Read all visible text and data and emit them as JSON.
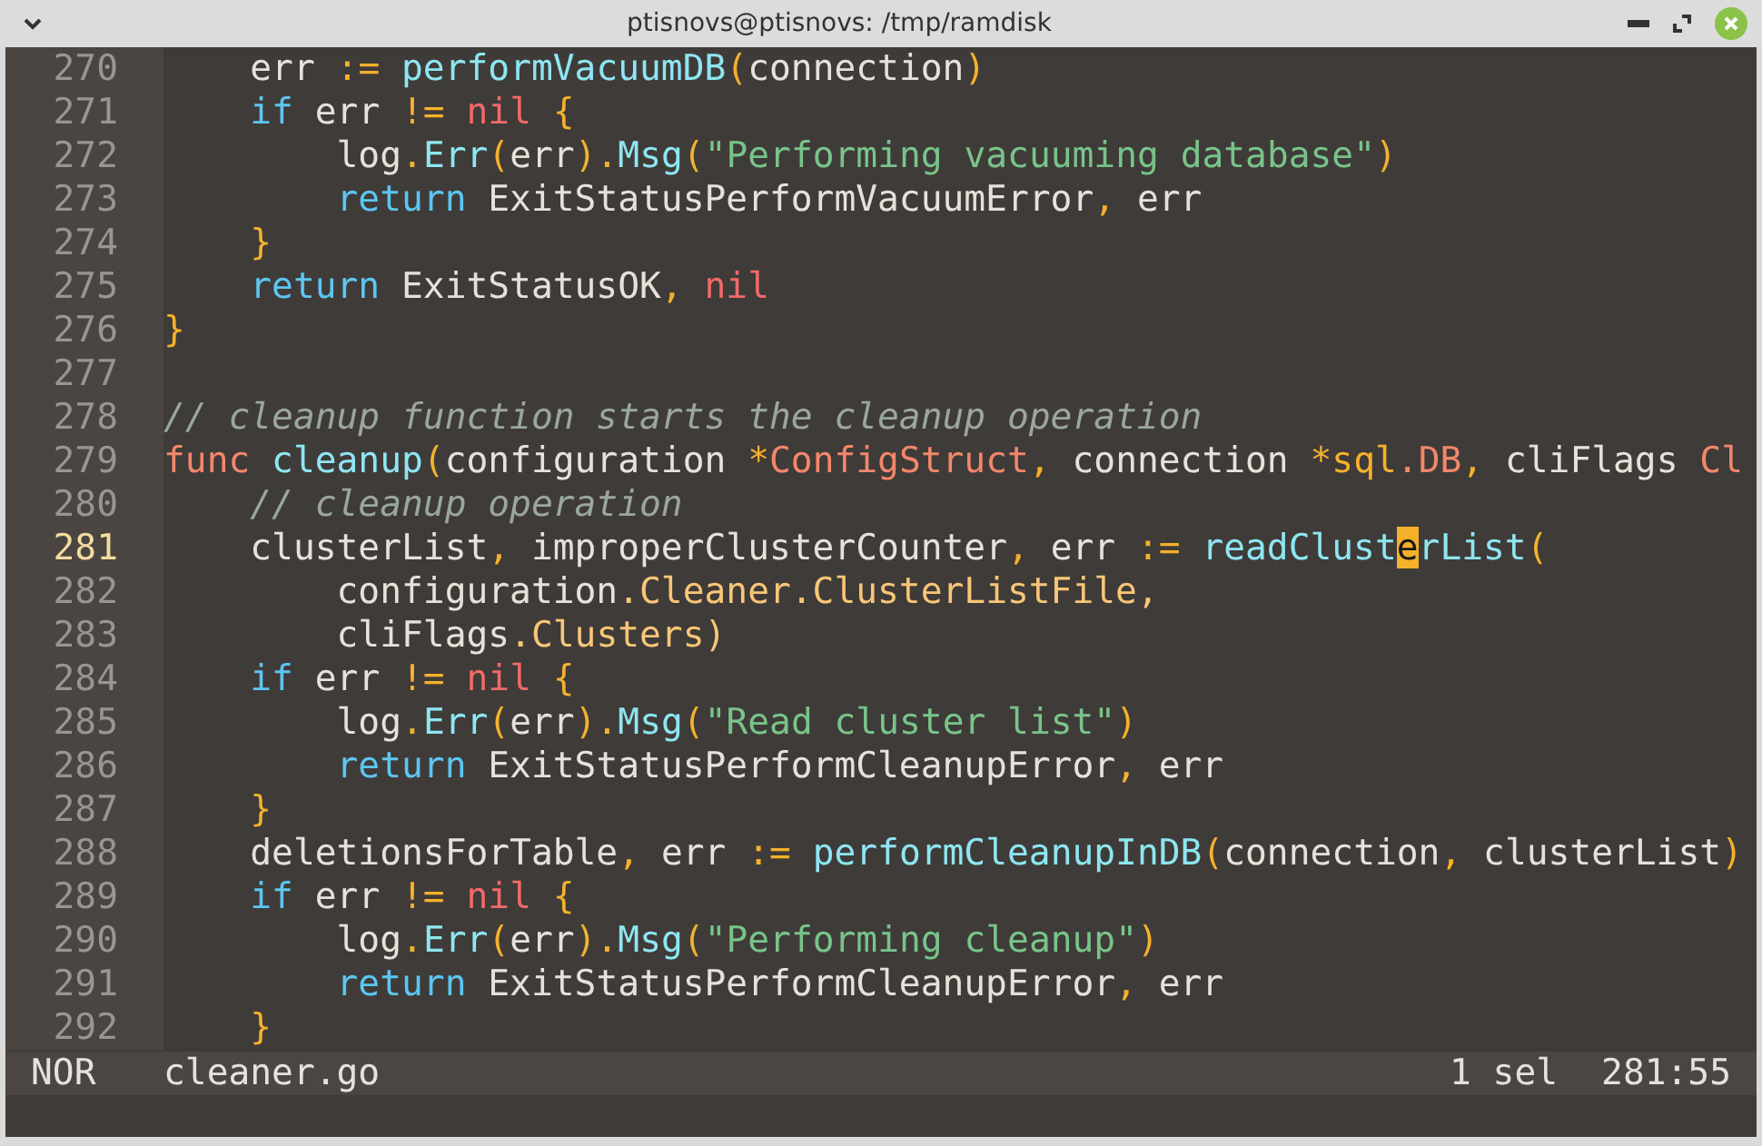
{
  "window": {
    "title": "ptisnovs@ptisnovs: /tmp/ramdisk"
  },
  "lines": [
    {
      "number": "270",
      "selected": false,
      "tokens": [
        {
          "text": "    err ",
          "kind": "plain"
        },
        {
          "text": ":=",
          "kind": "op"
        },
        {
          "text": " performVacuumDB",
          "kind": "fn"
        },
        {
          "text": "(",
          "kind": "op"
        },
        {
          "text": "connection",
          "kind": "plain"
        },
        {
          "text": ")",
          "kind": "op"
        }
      ]
    },
    {
      "number": "271",
      "selected": false,
      "tokens": [
        {
          "text": "    if",
          "kind": "kw"
        },
        {
          "text": " err ",
          "kind": "plain"
        },
        {
          "text": "!=",
          "kind": "op"
        },
        {
          "text": " nil",
          "kind": "const"
        },
        {
          "text": " {",
          "kind": "op"
        }
      ]
    },
    {
      "number": "272",
      "selected": false,
      "tokens": [
        {
          "text": "        log",
          "kind": "plain"
        },
        {
          "text": ".",
          "kind": "op"
        },
        {
          "text": "Err",
          "kind": "fn"
        },
        {
          "text": "(",
          "kind": "op"
        },
        {
          "text": "err",
          "kind": "plain"
        },
        {
          "text": ").",
          "kind": "op"
        },
        {
          "text": "Msg",
          "kind": "fn"
        },
        {
          "text": "(",
          "kind": "op"
        },
        {
          "text": "\"Performing vacuuming database\"",
          "kind": "str"
        },
        {
          "text": ")",
          "kind": "op"
        }
      ]
    },
    {
      "number": "273",
      "selected": false,
      "tokens": [
        {
          "text": "        return",
          "kind": "kw"
        },
        {
          "text": " ExitStatusPerformVacuumError",
          "kind": "plain"
        },
        {
          "text": ",",
          "kind": "op"
        },
        {
          "text": " err",
          "kind": "plain"
        }
      ]
    },
    {
      "number": "274",
      "selected": false,
      "tokens": [
        {
          "text": "    }",
          "kind": "op"
        }
      ]
    },
    {
      "number": "275",
      "selected": false,
      "tokens": [
        {
          "text": "    return",
          "kind": "kw"
        },
        {
          "text": " ExitStatusOK",
          "kind": "plain"
        },
        {
          "text": ",",
          "kind": "op"
        },
        {
          "text": " nil",
          "kind": "const"
        }
      ]
    },
    {
      "number": "276",
      "selected": false,
      "tokens": [
        {
          "text": "}",
          "kind": "op"
        }
      ]
    },
    {
      "number": "277",
      "selected": false
    },
    {
      "number": "278",
      "selected": false,
      "tokens": [
        {
          "text": "// cleanup function starts the cleanup operation",
          "kind": "comment"
        }
      ]
    },
    {
      "number": "279",
      "selected": false,
      "tokens": [
        {
          "text": "func",
          "kind": "type"
        },
        {
          "text": " cleanup",
          "kind": "fn"
        },
        {
          "text": "(",
          "kind": "op"
        },
        {
          "text": "configuration ",
          "kind": "plain"
        },
        {
          "text": "*",
          "kind": "op"
        },
        {
          "text": "ConfigStruct",
          "kind": "type"
        },
        {
          "text": ",",
          "kind": "op"
        },
        {
          "text": " connection ",
          "kind": "plain"
        },
        {
          "text": "*sql",
          "kind": "op"
        },
        {
          "text": ".DB",
          "kind": "type"
        },
        {
          "text": ",",
          "kind": "op"
        },
        {
          "text": " cliFlags ",
          "kind": "plain"
        },
        {
          "text": "Cl",
          "kind": "type"
        }
      ]
    },
    {
      "number": "280",
      "selected": false,
      "tokens": [
        {
          "text": "    // cleanup operation",
          "kind": "comment"
        }
      ]
    },
    {
      "number": "281",
      "selected": true,
      "tokens": [
        {
          "text": "    clusterList",
          "kind": "plain"
        },
        {
          "text": ",",
          "kind": "op"
        },
        {
          "text": " improperClusterCounter",
          "kind": "plain"
        },
        {
          "text": ",",
          "kind": "op"
        },
        {
          "text": " err ",
          "kind": "plain"
        },
        {
          "text": ":=",
          "kind": "op"
        },
        {
          "text": " readClust",
          "kind": "fn"
        },
        {
          "text": "e",
          "kind": "cursor"
        },
        {
          "text": "rList",
          "kind": "fn"
        },
        {
          "text": "(",
          "kind": "op"
        }
      ]
    },
    {
      "number": "282",
      "selected": false,
      "tokens": [
        {
          "text": "        configuration",
          "kind": "plain"
        },
        {
          "text": ".Cleaner.ClusterListFile,",
          "kind": "field"
        }
      ]
    },
    {
      "number": "283",
      "selected": false,
      "tokens": [
        {
          "text": "        cliFlags",
          "kind": "plain"
        },
        {
          "text": ".Clusters)",
          "kind": "field"
        }
      ]
    },
    {
      "number": "284",
      "selected": false,
      "tokens": [
        {
          "text": "    if",
          "kind": "kw"
        },
        {
          "text": " err ",
          "kind": "plain"
        },
        {
          "text": "!=",
          "kind": "op"
        },
        {
          "text": " nil",
          "kind": "const"
        },
        {
          "text": " {",
          "kind": "op"
        }
      ]
    },
    {
      "number": "285",
      "selected": false,
      "tokens": [
        {
          "text": "        log",
          "kind": "plain"
        },
        {
          "text": ".",
          "kind": "op"
        },
        {
          "text": "Err",
          "kind": "fn"
        },
        {
          "text": "(",
          "kind": "op"
        },
        {
          "text": "err",
          "kind": "plain"
        },
        {
          "text": ").",
          "kind": "op"
        },
        {
          "text": "Msg",
          "kind": "fn"
        },
        {
          "text": "(",
          "kind": "op"
        },
        {
          "text": "\"Read cluster list\"",
          "kind": "str"
        },
        {
          "text": ")",
          "kind": "op"
        }
      ]
    },
    {
      "number": "286",
      "selected": false,
      "tokens": [
        {
          "text": "        return",
          "kind": "kw"
        },
        {
          "text": " ExitStatusPerformCleanupError",
          "kind": "plain"
        },
        {
          "text": ",",
          "kind": "op"
        },
        {
          "text": " err",
          "kind": "plain"
        }
      ]
    },
    {
      "number": "287",
      "selected": false,
      "tokens": [
        {
          "text": "    }",
          "kind": "op"
        }
      ]
    },
    {
      "number": "288",
      "selected": false,
      "tokens": [
        {
          "text": "    deletionsForTable",
          "kind": "plain"
        },
        {
          "text": ",",
          "kind": "op"
        },
        {
          "text": " err ",
          "kind": "plain"
        },
        {
          "text": ":=",
          "kind": "op"
        },
        {
          "text": " performCleanupInDB",
          "kind": "fn"
        },
        {
          "text": "(",
          "kind": "op"
        },
        {
          "text": "connection",
          "kind": "plain"
        },
        {
          "text": ",",
          "kind": "op"
        },
        {
          "text": " clusterList",
          "kind": "plain"
        },
        {
          "text": ")",
          "kind": "op"
        }
      ]
    },
    {
      "number": "289",
      "selected": false,
      "tokens": [
        {
          "text": "    if",
          "kind": "kw"
        },
        {
          "text": " err ",
          "kind": "plain"
        },
        {
          "text": "!=",
          "kind": "op"
        },
        {
          "text": " nil",
          "kind": "const"
        },
        {
          "text": " {",
          "kind": "op"
        }
      ]
    },
    {
      "number": "290",
      "selected": false,
      "tokens": [
        {
          "text": "        log",
          "kind": "plain"
        },
        {
          "text": ".",
          "kind": "op"
        },
        {
          "text": "Err",
          "kind": "fn"
        },
        {
          "text": "(",
          "kind": "op"
        },
        {
          "text": "err",
          "kind": "plain"
        },
        {
          "text": ").",
          "kind": "op"
        },
        {
          "text": "Msg",
          "kind": "fn"
        },
        {
          "text": "(",
          "kind": "op"
        },
        {
          "text": "\"Performing cleanup\"",
          "kind": "str"
        },
        {
          "text": ")",
          "kind": "op"
        }
      ]
    },
    {
      "number": "291",
      "selected": false,
      "tokens": [
        {
          "text": "        return",
          "kind": "kw"
        },
        {
          "text": " ExitStatusPerformCleanupError",
          "kind": "plain"
        },
        {
          "text": ",",
          "kind": "op"
        },
        {
          "text": " err",
          "kind": "plain"
        }
      ]
    },
    {
      "number": "292",
      "selected": false,
      "tokens": [
        {
          "text": "    }",
          "kind": "op"
        }
      ]
    }
  ],
  "status_bar": {
    "mode": "NOR",
    "file": "cleaner.go",
    "selections": "1 sel",
    "position": "281:55"
  }
}
